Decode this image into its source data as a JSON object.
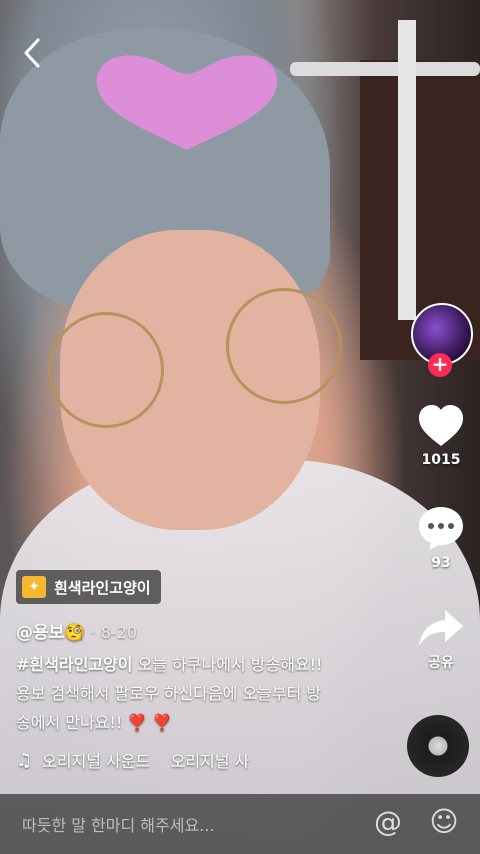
{
  "nav": {
    "back_icon": "chevron-left-icon"
  },
  "profile": {
    "follow_symbol": "+"
  },
  "actions": {
    "likes": "1015",
    "comments": "93",
    "share_label": "공유"
  },
  "hashtag_badge": {
    "icon": "sparkle-icon",
    "label": "흰색라인고양이"
  },
  "post": {
    "username": "@용보🧐",
    "date": " · 8-20",
    "caption_tag": "#흰색라인고양이",
    "caption_line1": " 오늘 하쿠나에서 방송해요!!",
    "caption_line2": "용보 검색해서 팔로우 하신다음에 오늘부터 방",
    "caption_line3": "송에서 만나요!! ❣️ ❣️"
  },
  "music": {
    "icon": "music-note-icon",
    "text": "오리지널 사운드    오리지널 사"
  },
  "comment_bar": {
    "placeholder": "따듯한 말 한마디 해주세요...",
    "mention_icon": "at-icon",
    "emoji_icon": "smiley-icon"
  },
  "colors": {
    "accent": "#fe2c55",
    "badge": "#f5b82e"
  }
}
